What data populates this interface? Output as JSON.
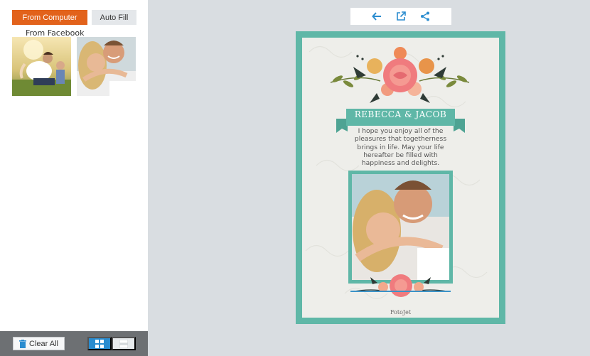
{
  "left_panel": {
    "tabs": {
      "from_computer": "From Computer",
      "auto_fill": "Auto Fill",
      "from_facebook": "From Facebook"
    },
    "thumbnails": [
      "couple-piggyback-photo",
      "couple-embrace-photo"
    ],
    "clear_all_label": "Clear All"
  },
  "toolbar": {
    "icons": [
      "arrow-left-icon",
      "external-open-icon",
      "share-icon"
    ]
  },
  "card": {
    "names": "REBECCA & JACOB",
    "message": "I hope you enjoy all of the pleasures that togetherness brings in life. May your life hereafter be filled with happiness and delights.",
    "brand": "FotoJet"
  },
  "colors": {
    "accent_orange": "#e2621b",
    "accent_blue": "#2a8ccf",
    "card_teal": "#5fb7a7",
    "flower_pink": "#f07b7e"
  }
}
